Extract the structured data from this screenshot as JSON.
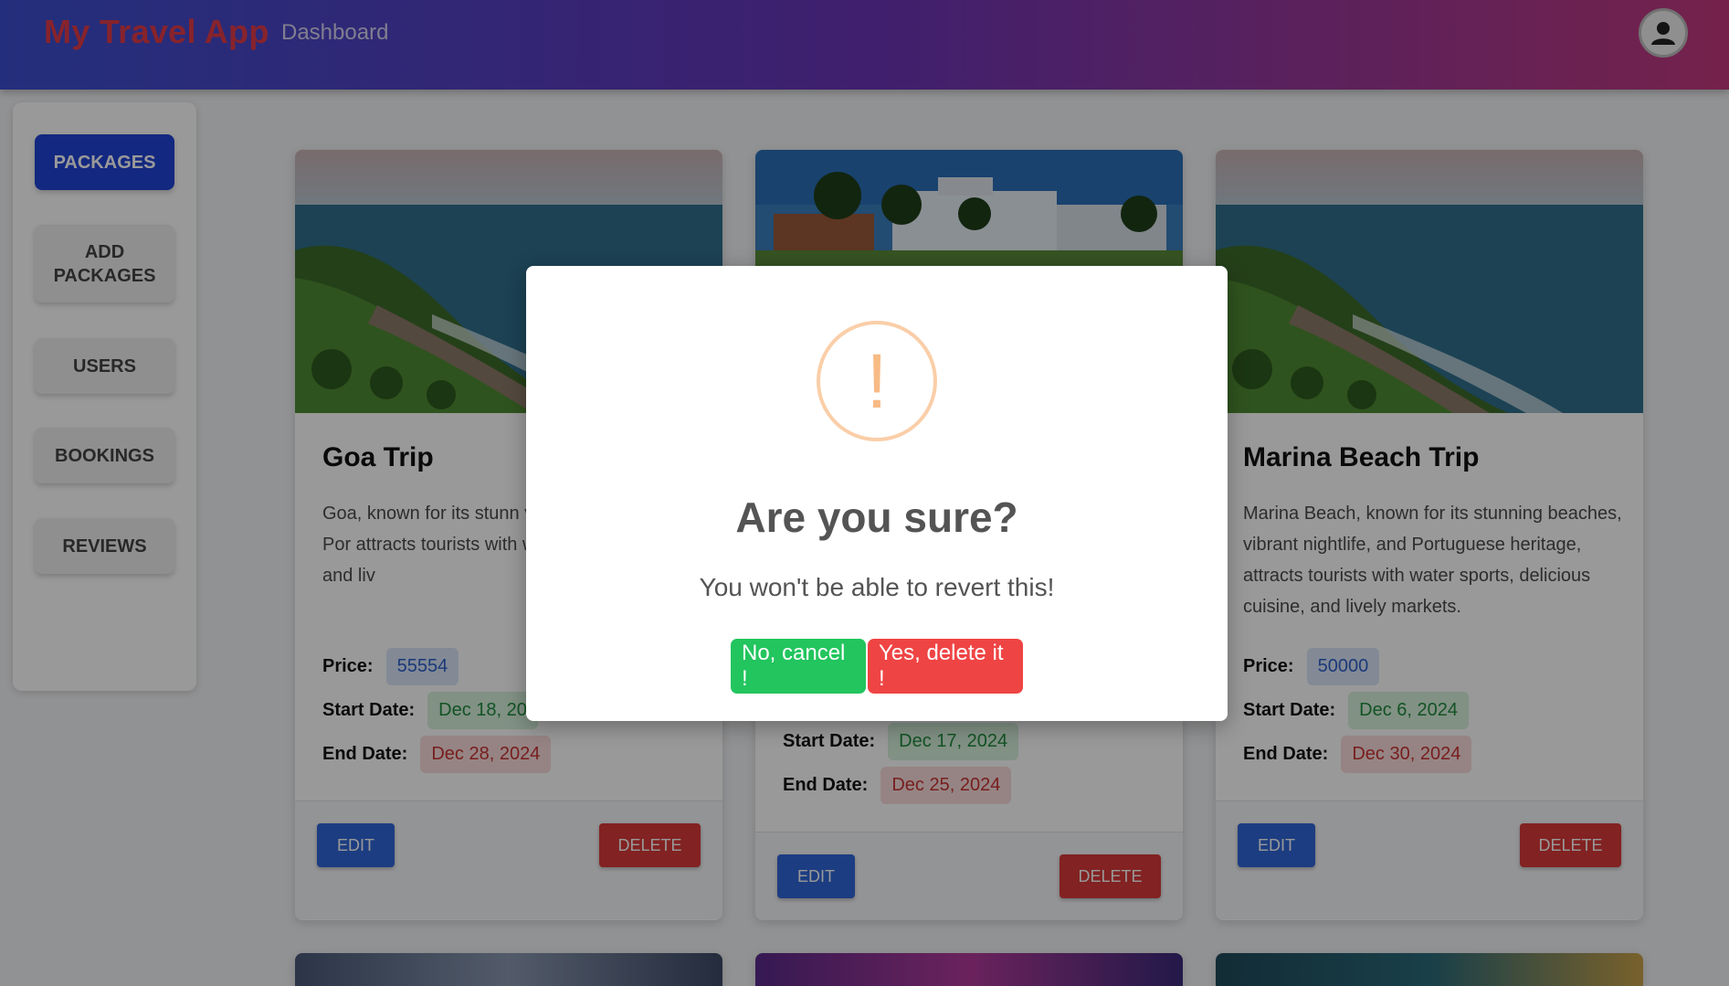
{
  "header": {
    "brand": "My Travel App",
    "nav_link": "Dashboard",
    "avatar_icon": "user-avatar-icon"
  },
  "sidebar": {
    "items": [
      {
        "label": "PACKAGES",
        "active": true
      },
      {
        "label": "ADD PACKAGES",
        "active": false
      },
      {
        "label": "USERS",
        "active": false
      },
      {
        "label": "BOOKINGS",
        "active": false
      },
      {
        "label": "REVIEWS",
        "active": false
      }
    ]
  },
  "labels": {
    "price": "Price:",
    "start_date": "Start Date:",
    "end_date": "End Date:",
    "edit": "EDIT",
    "delete": "DELETE"
  },
  "cards": [
    {
      "title": "Goa Trip",
      "description": "Goa, known for its stunn vibrant nightlife, and Por attracts tourists with wa delicious cuisine, and liv",
      "price": "55554",
      "start_date": "Dec 18, 20",
      "end_date": "Dec 28, 2024"
    },
    {
      "title": "",
      "description": "",
      "price": "",
      "start_date": "Dec 17, 2024",
      "end_date": "Dec 25, 2024"
    },
    {
      "title": "Marina Beach Trip",
      "description": "Marina Beach, known for its stunning beaches, vibrant nightlife, and Portuguese heritage, attracts tourists with water sports, delicious cuisine, and lively markets.",
      "price": "50000",
      "start_date": "Dec 6, 2024",
      "end_date": "Dec 30, 2024"
    }
  ],
  "modal": {
    "icon": "exclamation-icon",
    "icon_glyph": "!",
    "title": "Are you sure?",
    "text": "You won't be able to revert this!",
    "cancel_label": "No, cancel !",
    "confirm_label": "Yes, delete it !",
    "colors": {
      "cancel": "#22c55e",
      "confirm": "#ef4444",
      "icon": "#f8bb86"
    }
  }
}
